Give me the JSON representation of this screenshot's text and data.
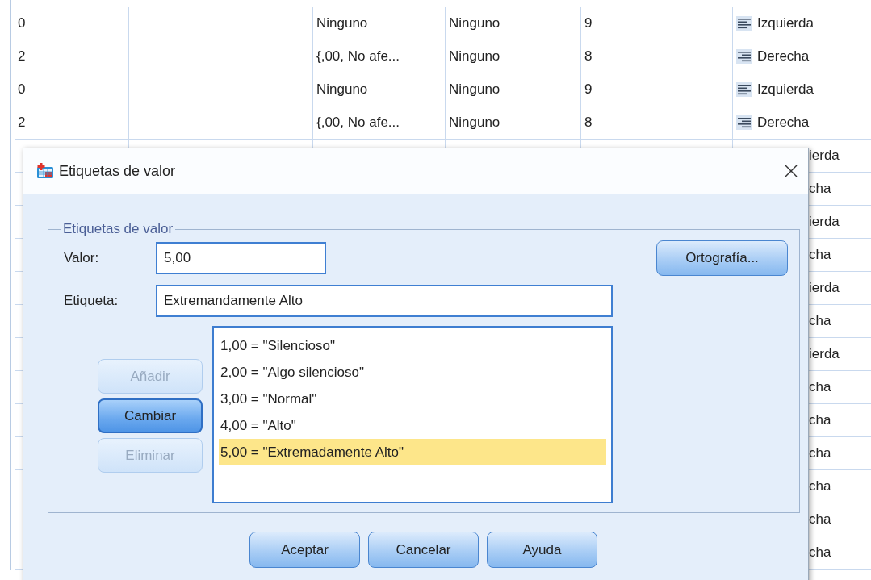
{
  "data_grid": {
    "rows": [
      {
        "column_1": "0",
        "column_3": "Ninguno",
        "column_4": "Ninguno",
        "column_5": "9",
        "column_6": {
          "kind": "left",
          "text": "Izquierda"
        }
      },
      {
        "column_1": "2",
        "column_3": "{,00, No afe...",
        "column_4": "Ninguno",
        "column_5": "8",
        "column_6": {
          "kind": "right",
          "text": "Derecha"
        }
      },
      {
        "column_1": "0",
        "column_3": "Ninguno",
        "column_4": "Ninguno",
        "column_5": "9",
        "column_6": {
          "kind": "left",
          "text": "Izquierda"
        }
      },
      {
        "column_1": "2",
        "column_3": "{,00, No afe...",
        "column_4": "Ninguno",
        "column_5": "8",
        "column_6": {
          "kind": "right",
          "text": "Derecha"
        }
      },
      {
        "column_6": {
          "text": "ierda"
        }
      },
      {
        "column_6": {
          "text": "cha"
        }
      },
      {
        "column_6": {
          "text": "ierda"
        }
      },
      {
        "column_6": {
          "text": "cha"
        }
      },
      {
        "column_6": {
          "text": "ierda"
        }
      },
      {
        "column_6": {
          "text": "cha"
        }
      },
      {
        "column_6": {
          "text": "ierda"
        }
      },
      {
        "column_6": {
          "text": "cha"
        }
      },
      {
        "column_6": {
          "text": "cha"
        }
      },
      {
        "column_6": {
          "text": "cha"
        }
      },
      {
        "column_6": {
          "text": "cha"
        }
      },
      {
        "column_6": {
          "text": "cha"
        }
      },
      {
        "column_6": {
          "text": "cha"
        }
      }
    ]
  },
  "dialog": {
    "title": "Etiquetas de valor",
    "group": {
      "legend": "Etiquetas de valor",
      "value_field": {
        "label": "Valor:",
        "value": "5,00"
      },
      "label_field": {
        "label": "Etiqueta:",
        "value": "Extremandamente Alto"
      },
      "spelling_button": {
        "label": "Ortografía..."
      },
      "action_buttons": [
        {
          "label": "Añadir",
          "disabled": true,
          "focused": false
        },
        {
          "label": "Cambiar",
          "disabled": false,
          "focused": true
        },
        {
          "label": "Eliminar",
          "disabled": true,
          "focused": false
        }
      ],
      "value_labels": [
        {
          "text": "1,00 = \"Silencioso\"",
          "selected": false
        },
        {
          "text": "2,00 = \"Algo silencioso\"",
          "selected": false
        },
        {
          "text": "3,00 = \"Normal\"",
          "selected": false
        },
        {
          "text": "4,00 = \"Alto\"",
          "selected": false
        },
        {
          "text": "5,00 = \"Extremadamente Alto\"",
          "selected": true
        }
      ]
    },
    "buttons": [
      {
        "label": "Aceptar"
      },
      {
        "label": "Cancelar"
      },
      {
        "label": "Ayuda"
      }
    ]
  }
}
